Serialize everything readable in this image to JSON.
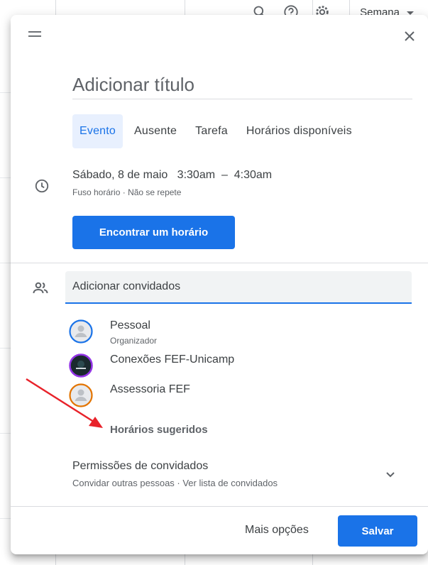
{
  "topbar": {
    "view_select": "Semana",
    "icons": [
      "search-icon",
      "help-icon",
      "settings-icon",
      "dropdown-arrow-icon"
    ]
  },
  "dialog": {
    "title_placeholder": "Adicionar título",
    "tabs": [
      {
        "label": "Evento",
        "active": true
      },
      {
        "label": "Ausente",
        "active": false
      },
      {
        "label": "Tarefa",
        "active": false
      },
      {
        "label": "Horários disponíveis",
        "active": false
      }
    ],
    "datetime": {
      "date": "Sábado, 8 de maio",
      "start": "3:30am",
      "separator": "–",
      "end": "4:30am",
      "timezone": "Fuso horário",
      "dot": "·",
      "recurrence": "Não se repete"
    },
    "find_time_button": "Encontrar um horário",
    "guests_placeholder": "Adicionar convidados",
    "guests": [
      {
        "name": "Pessoal",
        "role": "Organizador",
        "ring": "#1a73e8"
      },
      {
        "name": "Conexões FEF-Unicamp",
        "role": "",
        "ring": "#9334e6"
      },
      {
        "name": "Assessoria FEF",
        "role": "",
        "ring": "#e37400"
      }
    ],
    "suggested_times": "Horários sugeridos",
    "permissions": {
      "title": "Permissões de convidados",
      "subtitle": "Convidar outras pessoas · Ver lista de convidados"
    },
    "footer": {
      "more_options": "Mais opções",
      "save": "Salvar"
    }
  },
  "colors": {
    "accent": "#1a73e8",
    "annotation_arrow": "#e8222a"
  }
}
